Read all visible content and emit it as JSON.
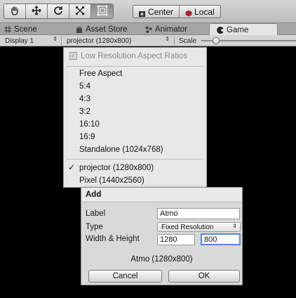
{
  "toolbar": {
    "tools": [
      {
        "icon": "hand-icon",
        "glyph": "✋"
      },
      {
        "icon": "move-icon",
        "glyph": "✥"
      },
      {
        "icon": "rotate-icon",
        "glyph": "↻"
      },
      {
        "icon": "scale-icon",
        "glyph": "⤡"
      },
      {
        "icon": "rect-icon",
        "glyph": "▣"
      }
    ],
    "center_label": "Center",
    "local_label": "Local"
  },
  "tabs": [
    {
      "label": "Scene",
      "icon": "grid-icon"
    },
    {
      "label": "Asset Store",
      "icon": "bag-icon"
    },
    {
      "label": "Animator",
      "icon": "animator-icon"
    },
    {
      "label": "Game",
      "icon": "pacman-icon"
    }
  ],
  "gamebar": {
    "display": "Display 1",
    "aspect": "projector (1280x800)",
    "scale_label": "Scale"
  },
  "menu": {
    "low_res_label": "Low Resolution Aspect Ratios",
    "items": [
      "Free Aspect",
      "5:4",
      "4:3",
      "3:2",
      "16:10",
      "16:9",
      "Standalone (1024x768)"
    ],
    "custom_items": [
      "projector (1280x800)",
      "Pixel (1440x2560)"
    ],
    "checkmark": "✓"
  },
  "dialog": {
    "title": "Add",
    "label_caption": "Label",
    "label_value": "Atmo",
    "type_caption": "Type",
    "type_value": "Fixed Resolution",
    "size_caption": "Width & Height",
    "width_value": "1280",
    "height_value": "800",
    "summary": "Atmo (1280x800)",
    "cancel_label": "Cancel",
    "ok_label": "OK"
  },
  "colors": {
    "focus_border": "#5b87d6",
    "viewport_bg": "#000000"
  }
}
